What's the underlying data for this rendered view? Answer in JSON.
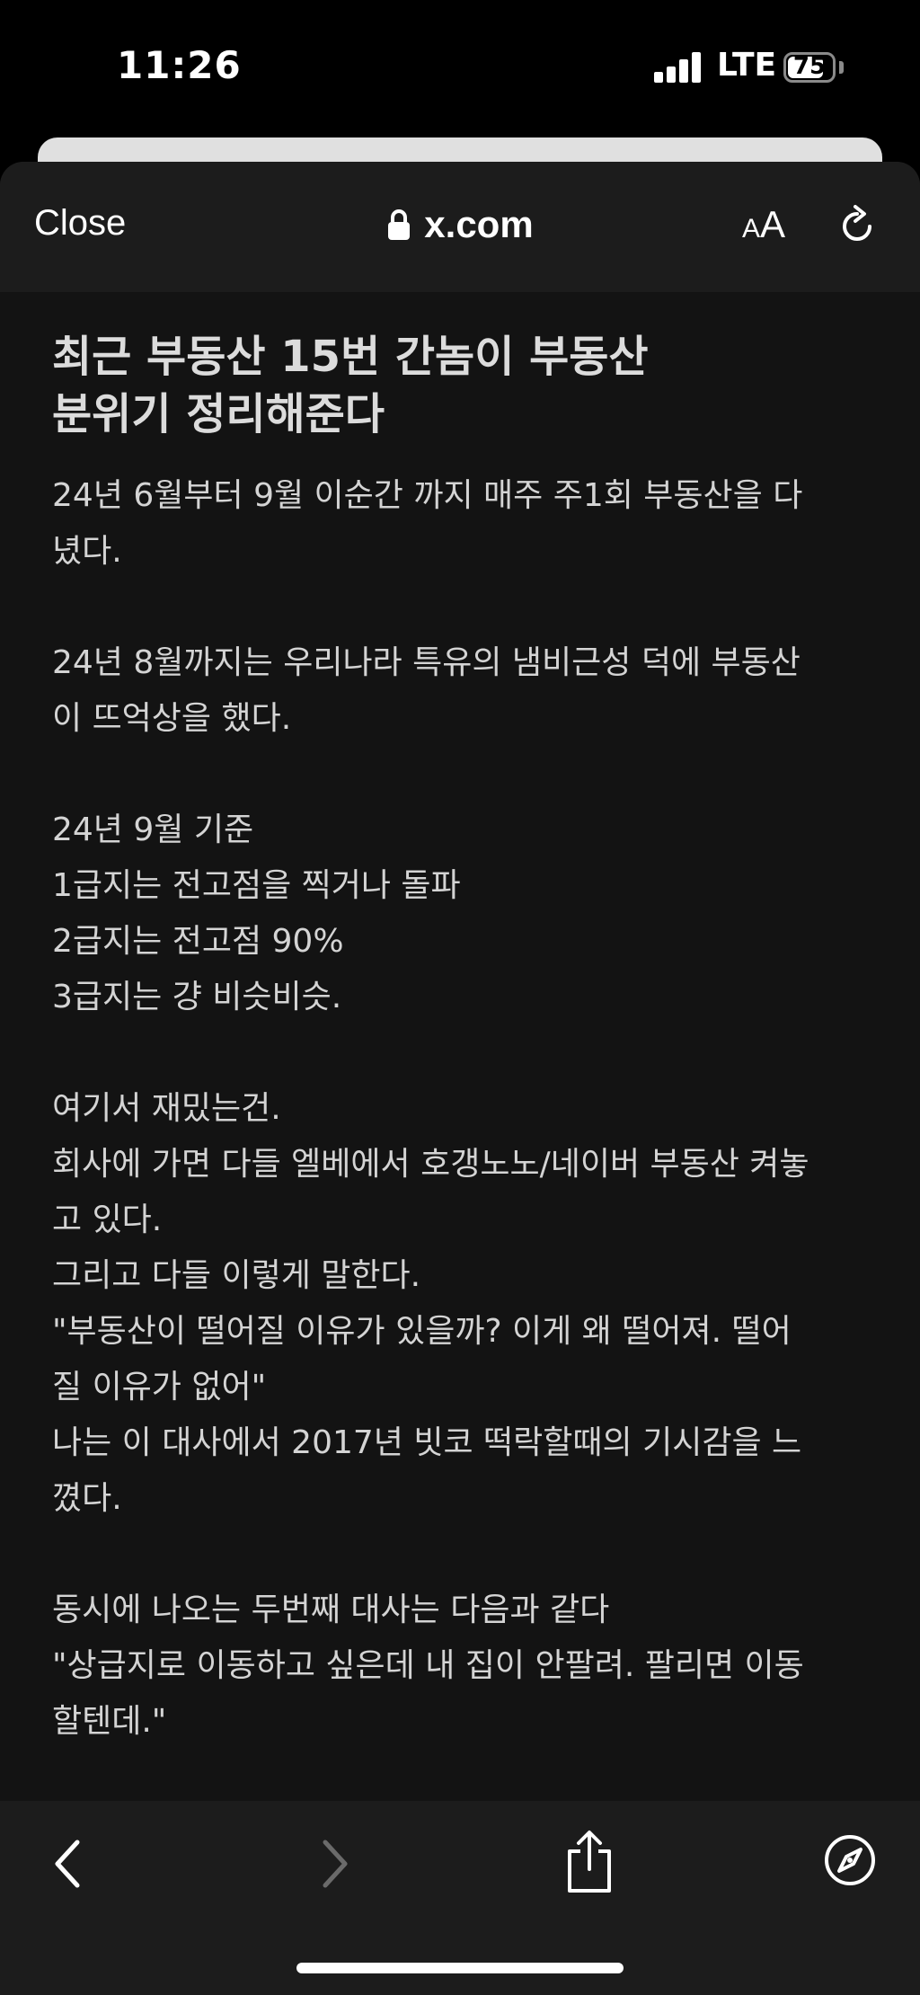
{
  "status_bar": {
    "time": "11:26",
    "network": "LTE",
    "battery_level": "75"
  },
  "nav": {
    "close_label": "Close",
    "url": "x.com",
    "text_size_label_small": "A",
    "text_size_label_large": "A"
  },
  "article": {
    "title_lines": [
      "최근 부동산 15번 간놈이 부동산",
      "분위기 정리해준다"
    ],
    "paragraphs": [
      [
        "24년 6월부터 9월 이순간 까지 매주 주1회 부동산을 다",
        "녔다."
      ],
      [
        "24년 8월까지는 우리나라 특유의 냄비근성 덕에 부동산",
        "이 뜨억상을 했다."
      ],
      [
        "24년 9월 기준",
        "1급지는 전고점을 찍거나 돌파",
        "2급지는 전고점 90%",
        "3급지는 걍 비슷비슷."
      ],
      [
        "여기서 재밌는건.",
        "회사에 가면 다들 엘베에서 호갱노노/네이버 부동산 켜놓",
        "고 있다.",
        "그리고 다들 이렇게 말한다.",
        "\"부동산이 떨어질 이유가 있을까? 이게 왜 떨어져. 떨어",
        "질 이유가 없어\"",
        "나는 이 대사에서 2017년 빗코 떡락할때의 기시감을 느",
        "꼈다."
      ],
      [
        "동시에 나오는 두번째 대사는 다음과 같다",
        "\"상급지로 이동하고 싶은데 내 집이 안팔려. 팔리면 이동",
        "할텐데.\""
      ]
    ]
  },
  "toolbar": {
    "back": "chevron-left-icon",
    "forward": "chevron-right-icon",
    "share": "share-icon",
    "compass": "compass-icon"
  },
  "colors": {
    "background": "#000000",
    "sheet": "#131313",
    "bar": "#1c1c1c",
    "text": "#d4d4d4",
    "disabled": "#6a6a6a"
  }
}
